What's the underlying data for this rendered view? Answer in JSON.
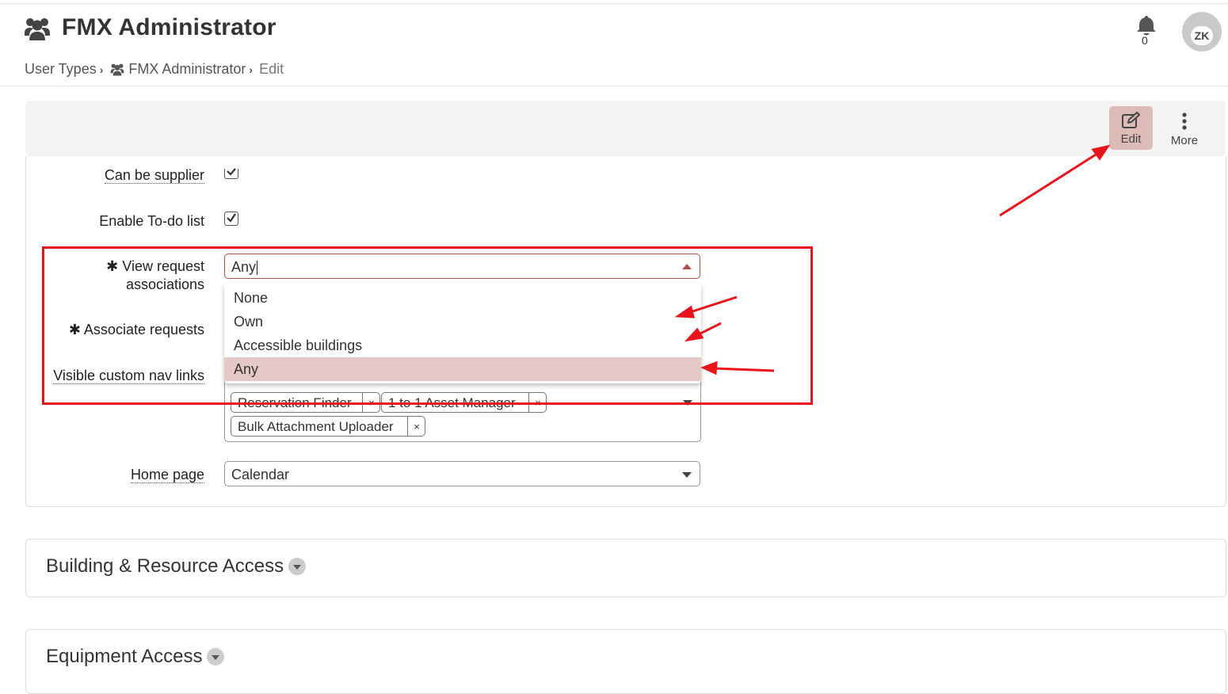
{
  "header": {
    "title": "FMX Administrator",
    "notification_count": "0",
    "avatar_initials": "ZK"
  },
  "breadcrumb": {
    "items": [
      "User Types",
      "FMX Administrator",
      "Edit"
    ]
  },
  "toolbar": {
    "edit_label": "Edit",
    "more_label": "More"
  },
  "form": {
    "can_be_supplier": {
      "label": "Can be supplier",
      "checked": true
    },
    "enable_todo": {
      "label": "Enable To-do list",
      "checked": true
    },
    "view_request": {
      "label_line1": "View request",
      "label_line2": "associations",
      "required_mark": "✱",
      "value": "Any",
      "options": [
        "None",
        "Own",
        "Accessible buildings",
        "Any"
      ],
      "selected": "Any"
    },
    "associate_requests": {
      "label": "Associate requests",
      "required_mark": "✱"
    },
    "visible_nav_links": {
      "label": "Visible custom nav links",
      "chips": [
        "Reservation Finder",
        "1 to 1 Asset Manager",
        "Bulk Attachment Uploader"
      ],
      "remove_glyph": "×"
    },
    "home_page": {
      "label": "Home page",
      "value": "Calendar"
    }
  },
  "sections": {
    "building_access": "Building & Resource Access",
    "equipment_access": "Equipment Access"
  },
  "colors": {
    "accent": "#b0504b",
    "edit_button_bg": "#ddbcb8",
    "selected_option_bg": "#e5c9c6",
    "annotation_red": "#e8141c"
  }
}
